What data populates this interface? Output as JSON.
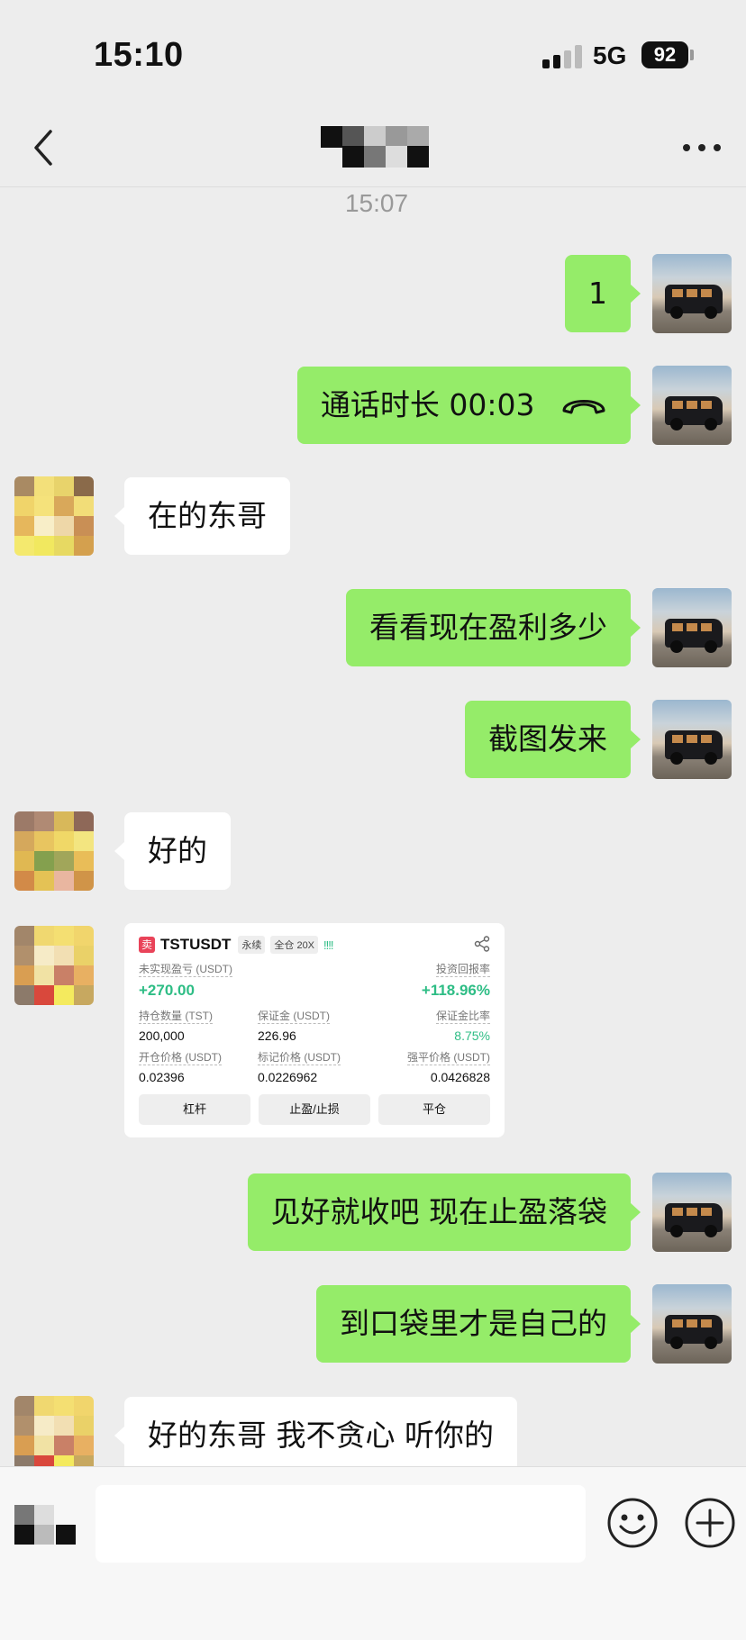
{
  "status_bar": {
    "time": "15:10",
    "network": "5G",
    "battery": "92"
  },
  "chat": {
    "contact_name": "",
    "timestamp": "15:07",
    "messages": [
      {
        "side": "out",
        "text": "1"
      },
      {
        "side": "out",
        "text": "通话时长 00:03",
        "icon": "phone-hangup-icon"
      },
      {
        "side": "in",
        "text": "在的东哥"
      },
      {
        "side": "out",
        "text": "看看现在盈利多少"
      },
      {
        "side": "out",
        "text": "截图发来"
      },
      {
        "side": "in",
        "text": "好的"
      },
      {
        "side": "in",
        "type": "image"
      },
      {
        "side": "out",
        "text": "见好就收吧 现在止盈落袋"
      },
      {
        "side": "out",
        "text": "到口袋里才是自己的"
      },
      {
        "side": "in",
        "text": "好的东哥 我不贪心 听你的"
      }
    ]
  },
  "position_card": {
    "side_badge": "卖",
    "symbol": "TSTUSDT",
    "contract_type": "永续",
    "margin_mode": "全仓 20X",
    "signal": "!!!!",
    "unrealized_pnl_label": "未实现盈亏 (USDT)",
    "unrealized_pnl": "+270.00",
    "roi_label": "投资回报率",
    "roi": "+118.96%",
    "position_size_label": "持仓数量 (TST)",
    "position_size": "200,000",
    "margin_label": "保证金 (USDT)",
    "margin": "226.96",
    "margin_ratio_label": "保证金比率",
    "margin_ratio": "8.75%",
    "entry_price_label": "开仓价格 (USDT)",
    "entry_price": "0.02396",
    "mark_price_label": "标记价格 (USDT)",
    "mark_price": "0.0226962",
    "liq_price_label": "强平价格 (USDT)",
    "liq_price": "0.0426828",
    "buttons": {
      "leverage": "杠杆",
      "tpsl": "止盈/止损",
      "close": "平仓"
    }
  },
  "input_bar": {
    "placeholder": ""
  },
  "colors": {
    "bubble_out": "#95ec69",
    "bubble_in": "#ffffff",
    "background": "#ededed",
    "profit_green": "#2ebd85",
    "sell_red": "#e94359"
  }
}
